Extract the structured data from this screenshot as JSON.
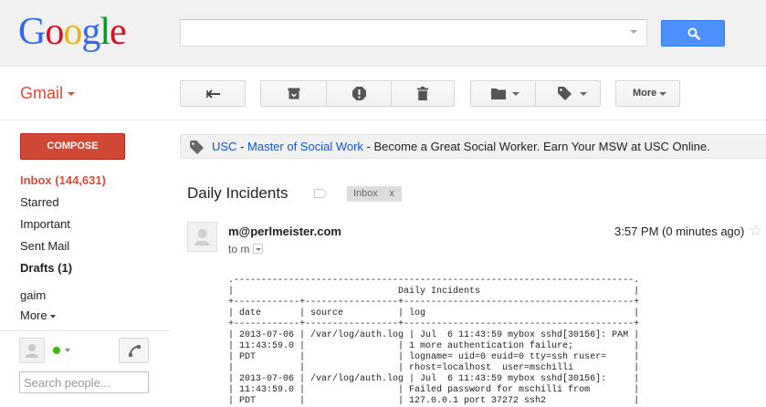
{
  "header": {
    "logo_letters": [
      {
        "ch": "G",
        "color": "#3369e8"
      },
      {
        "ch": "o",
        "color": "#d50f25"
      },
      {
        "ch": "o",
        "color": "#eeb211"
      },
      {
        "ch": "g",
        "color": "#3369e8"
      },
      {
        "ch": "l",
        "color": "#009925"
      },
      {
        "ch": "e",
        "color": "#d50f25"
      }
    ],
    "search_value": "",
    "search_button_icon": "magnifier-icon"
  },
  "app": {
    "product_label": "Gmail"
  },
  "toolbar": {
    "more_label": "More",
    "icons": [
      "back-arrow-icon",
      "archive-icon",
      "report-spam-icon",
      "delete-icon",
      "folder-icon",
      "label-icon"
    ]
  },
  "nav": {
    "compose_label": "COMPOSE",
    "items": [
      {
        "label": "Inbox (144,631)"
      },
      {
        "label": "Starred"
      },
      {
        "label": "Important"
      },
      {
        "label": "Sent Mail"
      },
      {
        "label": "Drafts (1)"
      },
      {
        "label": "gaim"
      },
      {
        "label": "More"
      }
    ],
    "search_people_placeholder": "Search people..."
  },
  "ad": {
    "sponsor": "USC",
    "sep1": " - ",
    "link": "Master of Social Work",
    "sep2": " - ",
    "text": "Become a Great Social Worker. Earn Your MSW at USC Online."
  },
  "message": {
    "subject": "Daily Incidents",
    "label_chip": "Inbox",
    "label_chip_close": "x",
    "sender": "m@perlmeister.com",
    "to_line": "to m",
    "time": "3:57 PM (0 minutes ago)",
    "body_lines": [
      ".-------------------------------------------------------------------------.",
      "|                              Daily Incidents                            |",
      "+------------+-----------------+------------------------------------------+",
      "| date       | source          | log                                      |",
      "+------------+-----------------+------------------------------------------+",
      "| 2013-07-06 | /var/log/auth.log | Jul  6 11:43:59 mybox sshd[30156]: PAM |",
      "| 11:43:59.0 |                 | 1 more authentication failure;           |",
      "| PDT        |                 | logname= uid=0 euid=0 tty=ssh ruser=     |",
      "|            |                 | rhost=localhost  user=mschilli           |",
      "| 2013-07-06 | /var/log/auth.log | Jul  6 11:43:59 mybox sshd[30156]:     |",
      "| 11:43:59.0 |                 | Failed password for mschilli from        |",
      "| PDT        |                 | 127.0.0.1 port 37272 ssh2                |"
    ]
  }
}
